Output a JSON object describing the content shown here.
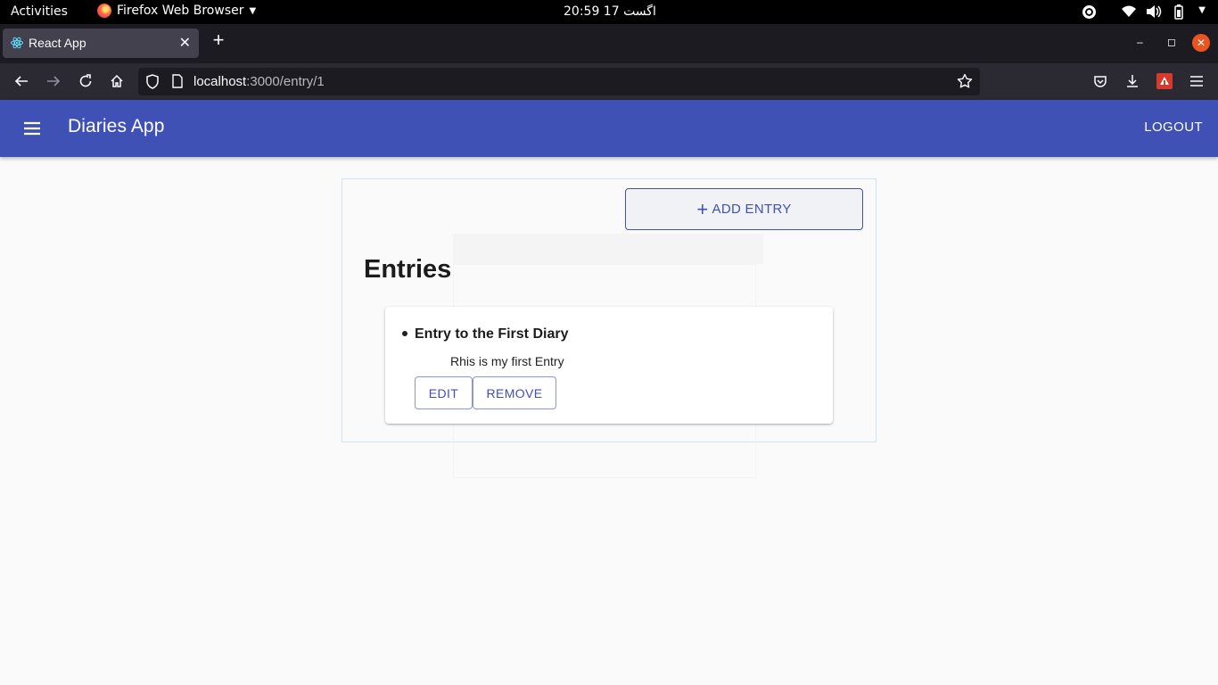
{
  "os_topbar": {
    "activities": "Activities",
    "app_menu": "Firefox Web Browser",
    "clock": "20:59  17 اگست"
  },
  "browser": {
    "tab_title": "React App",
    "url_host": "localhost",
    "url_path": ":3000/entry/1"
  },
  "app": {
    "title": "Diaries App",
    "logout_label": "LOGOUT",
    "add_entry_label": "ADD ENTRY",
    "entries_heading": "Entries",
    "entries": [
      {
        "title": "Entry to the First Diary",
        "content": "Rhis is my first Entry",
        "edit_label": "EDIT",
        "remove_label": "REMOVE"
      }
    ]
  },
  "colors": {
    "primary": "#3f51b5",
    "tab_bar": "#1c1b22",
    "nav_bar": "#2b2a33",
    "close_button": "#e95420"
  }
}
